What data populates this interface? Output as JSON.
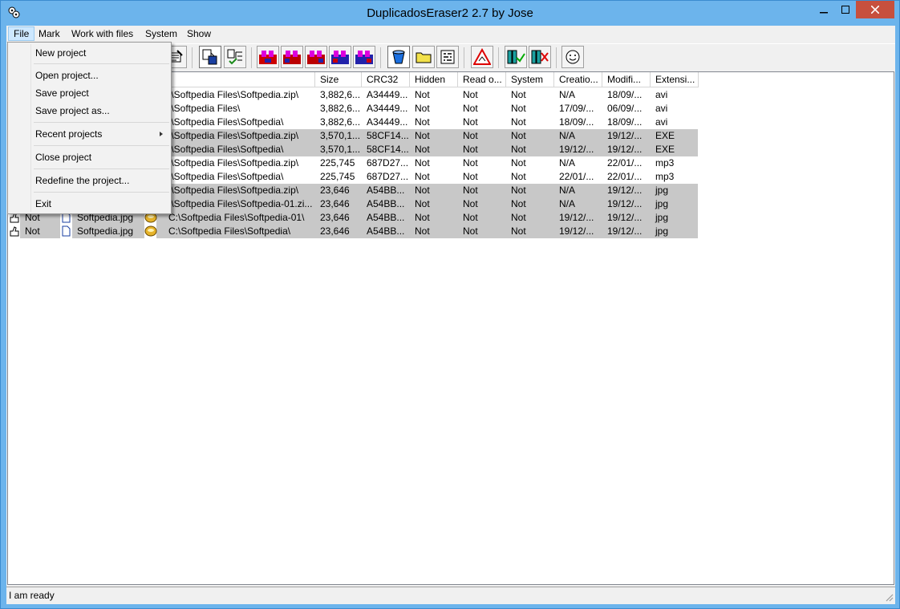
{
  "window": {
    "title": "DuplicadosEraser2 2.7 by Jose",
    "colors": {
      "titlebar": "#6cb4ec",
      "close": "#c7503e",
      "row_shade": "#c8c8c8"
    }
  },
  "menubar": {
    "items": [
      {
        "label": "File",
        "active": true
      },
      {
        "label": "Mark"
      },
      {
        "label": "Work with files"
      },
      {
        "label": "System"
      },
      {
        "label": "Show"
      }
    ]
  },
  "file_menu": {
    "items": [
      {
        "label": "New project"
      },
      {
        "label": "Open project..."
      },
      {
        "label": "Save project"
      },
      {
        "label": "Save project as..."
      },
      {
        "label": "Recent projects",
        "submenu": true
      },
      {
        "label": "Close project"
      },
      {
        "label": "Redefine the project..."
      },
      {
        "label": "Exit"
      }
    ]
  },
  "toolbar": {
    "icons": [
      "edit-icon",
      "select-file-icon",
      "select-tree-icon",
      "mark-group-1-icon",
      "mark-group-2-icon",
      "mark-group-3-icon",
      "mark-group-4-icon",
      "mark-group-5-icon",
      "bucket-icon",
      "folder-icon",
      "settings-icon",
      "warning-icon",
      "confirm-icon",
      "delete-icon",
      "smiley-icon"
    ]
  },
  "list": {
    "columns": [
      "Size",
      "CRC32",
      "Hidden",
      "Read o...",
      "System",
      "Creatio...",
      "Modifi...",
      "Extensi..."
    ],
    "rows": [
      {
        "c0": "",
        "c1": "",
        "path": ":\\Softpedia Files\\Softpedia.zip\\",
        "size": "3,882,6...",
        "crc": "A34449...",
        "hidden": "Not",
        "read": "Not",
        "system": "Not",
        "created": "N/A",
        "modified": "18/09/...",
        "ext": "avi",
        "shade": false
      },
      {
        "c0": "",
        "c1": "",
        "path": ":\\Softpedia Files\\",
        "size": "3,882,6...",
        "crc": "A34449...",
        "hidden": "Not",
        "read": "Not",
        "system": "Not",
        "created": "17/09/...",
        "modified": "06/09/...",
        "ext": "avi",
        "shade": false
      },
      {
        "c0": "",
        "c1": "",
        "path": ":\\Softpedia Files\\Softpedia\\",
        "size": "3,882,6...",
        "crc": "A34449...",
        "hidden": "Not",
        "read": "Not",
        "system": "Not",
        "created": "18/09/...",
        "modified": "18/09/...",
        "ext": "avi",
        "shade": false
      },
      {
        "c0": "",
        "c1": "",
        "path": ":\\Softpedia Files\\Softpedia.zip\\",
        "size": "3,570,1...",
        "crc": "58CF14...",
        "hidden": "Not",
        "read": "Not",
        "system": "Not",
        "created": "N/A",
        "modified": "19/12/...",
        "ext": "EXE",
        "shade": true
      },
      {
        "c0": "",
        "c1": "",
        "path": ":\\Softpedia Files\\Softpedia\\",
        "size": "3,570,1...",
        "crc": "58CF14...",
        "hidden": "Not",
        "read": "Not",
        "system": "Not",
        "created": "19/12/...",
        "modified": "19/12/...",
        "ext": "EXE",
        "shade": true
      },
      {
        "c0": "",
        "c1": "",
        "path": ":\\Softpedia Files\\Softpedia.zip\\",
        "size": "225,745",
        "crc": "687D27...",
        "hidden": "Not",
        "read": "Not",
        "system": "Not",
        "created": "N/A",
        "modified": "22/01/...",
        "ext": "mp3",
        "shade": false
      },
      {
        "c0": "",
        "c1": "",
        "path": ":\\Softpedia Files\\Softpedia\\",
        "size": "225,745",
        "crc": "687D27...",
        "hidden": "Not",
        "read": "Not",
        "system": "Not",
        "created": "22/01/...",
        "modified": "22/01/...",
        "ext": "mp3",
        "shade": false
      },
      {
        "c0": "",
        "c1": "",
        "path": ":\\Softpedia Files\\Softpedia.zip\\",
        "size": "23,646",
        "crc": "A54BB...",
        "hidden": "Not",
        "read": "Not",
        "system": "Not",
        "created": "N/A",
        "modified": "19/12/...",
        "ext": "jpg",
        "shade": true
      },
      {
        "c0": "",
        "c1": "",
        "path": ":\\Softpedia Files\\Softpedia-01.zi...",
        "size": "23,646",
        "crc": "A54BB...",
        "hidden": "Not",
        "read": "Not",
        "system": "Not",
        "created": "N/A",
        "modified": "19/12/...",
        "ext": "jpg",
        "shade": true
      },
      {
        "c0": "Not",
        "c1": "Softpedia.jpg",
        "path": "C:\\Softpedia Files\\Softpedia-01\\",
        "size": "23,646",
        "crc": "A54BB...",
        "hidden": "Not",
        "read": "Not",
        "system": "Not",
        "created": "19/12/...",
        "modified": "19/12/...",
        "ext": "jpg",
        "shade": true
      },
      {
        "c0": "Not",
        "c1": "Softpedia.jpg",
        "path": "C:\\Softpedia Files\\Softpedia\\",
        "size": "23,646",
        "crc": "A54BB...",
        "hidden": "Not",
        "read": "Not",
        "system": "Not",
        "created": "19/12/...",
        "modified": "19/12/...",
        "ext": "jpg",
        "shade": true
      }
    ]
  },
  "status": {
    "text": "I am ready"
  }
}
